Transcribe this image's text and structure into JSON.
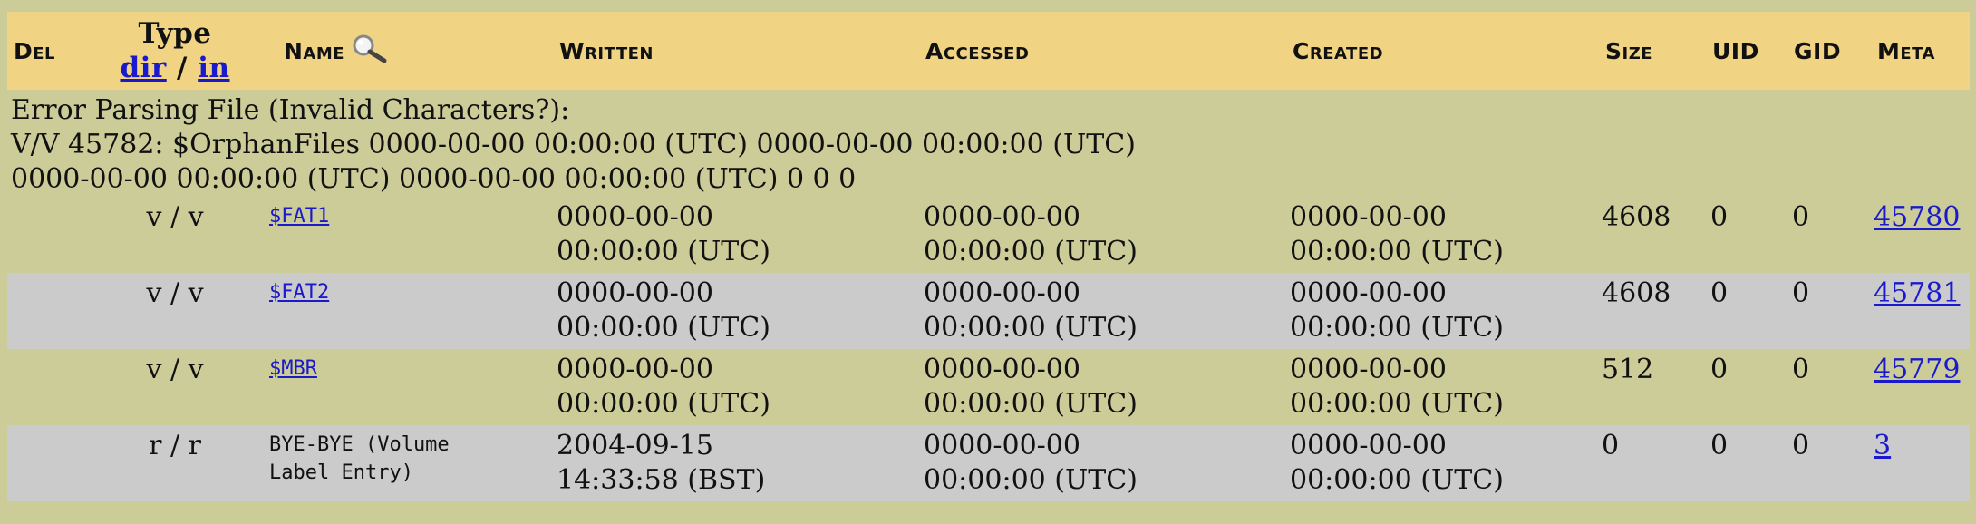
{
  "header": {
    "del": "Del",
    "type_label": "Type",
    "type_dir": "dir",
    "type_sep": " / ",
    "type_in": "in",
    "name": "Name",
    "written": "Written",
    "accessed": "Accessed",
    "created": "Created",
    "size": "Size",
    "uid": "UID",
    "gid": "GID",
    "meta": "Meta"
  },
  "error": {
    "line1": "Error Parsing File (Invalid Characters?):",
    "line2": "V/V 45782: $OrphanFiles 0000-00-00 00:00:00 (UTC) 0000-00-00 00:00:00 (UTC)",
    "line3": "0000-00-00 00:00:00 (UTC) 0000-00-00 00:00:00 (UTC) 0 0 0"
  },
  "rows": [
    {
      "type": "v / v",
      "name": "$FAT1",
      "written_date": "0000-00-00",
      "written_time": "00:00:00 (UTC)",
      "accessed_date": "0000-00-00",
      "accessed_time": "00:00:00 (UTC)",
      "created_date": "0000-00-00",
      "created_time": "00:00:00 (UTC)",
      "size": "4608",
      "uid": "0",
      "gid": "0",
      "meta": "45780"
    },
    {
      "type": "v / v",
      "name": "$FAT2",
      "written_date": "0000-00-00",
      "written_time": "00:00:00 (UTC)",
      "accessed_date": "0000-00-00",
      "accessed_time": "00:00:00 (UTC)",
      "created_date": "0000-00-00",
      "created_time": "00:00:00 (UTC)",
      "size": "4608",
      "uid": "0",
      "gid": "0",
      "meta": "45781"
    },
    {
      "type": "v / v",
      "name": "$MBR",
      "written_date": "0000-00-00",
      "written_time": "00:00:00 (UTC)",
      "accessed_date": "0000-00-00",
      "accessed_time": "00:00:00 (UTC)",
      "created_date": "0000-00-00",
      "created_time": "00:00:00 (UTC)",
      "size": "512",
      "uid": "0",
      "gid": "0",
      "meta": "45779"
    },
    {
      "type": "r / r",
      "name_line1": "BYE-BYE (Volume",
      "name_line2": "Label Entry)",
      "written_date": "2004-09-15",
      "written_time": "14:33:58 (BST)",
      "accessed_date": "0000-00-00",
      "accessed_time": "00:00:00 (UTC)",
      "created_date": "0000-00-00",
      "created_time": "00:00:00 (UTC)",
      "size": "0",
      "uid": "0",
      "gid": "0",
      "meta": "3"
    }
  ],
  "colors": {
    "page_bg": "#cccc99",
    "header_bg": "#f0d484",
    "alt_row_bg": "#cbcbcb",
    "link": "#1a1acc"
  },
  "icons": {
    "name_search": "magnifier-icon"
  }
}
